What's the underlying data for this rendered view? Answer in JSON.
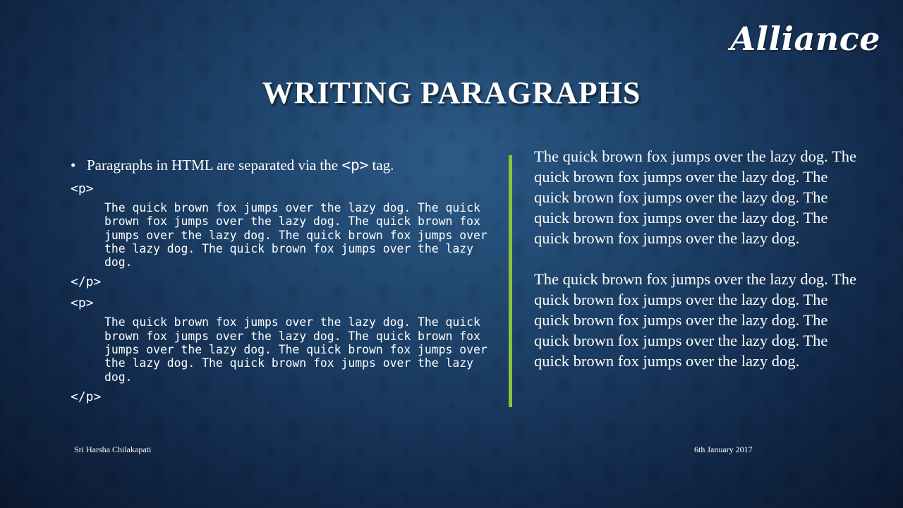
{
  "logo": {
    "text": "Alliance"
  },
  "title": "WRITING PARAGRAPHS",
  "left": {
    "bullet_prefix": "Paragraphs in HTML are separated via the ",
    "bullet_code": "<p>",
    "bullet_suffix": " tag.",
    "blocks": [
      {
        "open_tag": "<p>",
        "text": "The quick brown fox jumps over the lazy dog. The quick brown fox jumps over the lazy dog. The quick brown fox jumps over the lazy dog. The quick brown fox jumps over the lazy dog. The quick brown fox jumps over the lazy dog.",
        "close_tag": "</p>"
      },
      {
        "open_tag": "<p>",
        "text": "The quick brown fox jumps over the lazy dog. The quick brown fox jumps over the lazy dog. The quick brown fox jumps over the lazy dog. The quick brown fox jumps over the lazy dog. The quick brown fox jumps over the lazy dog.",
        "close_tag": "</p>"
      }
    ]
  },
  "right": {
    "paragraphs": [
      "The quick brown fox jumps over the lazy dog. The quick brown fox jumps over the lazy dog. The quick brown fox jumps over the lazy dog. The quick brown fox jumps over the lazy dog. The quick brown fox jumps over the lazy dog.",
      "The quick brown fox jumps over the lazy dog. The quick brown fox jumps over the lazy dog. The quick brown fox jumps over the lazy dog. The quick brown fox jumps over the lazy dog. The quick brown fox jumps over the lazy dog."
    ]
  },
  "footer": {
    "author": "Sri Harsha Chilakapati",
    "date": "6th January 2017"
  },
  "colors": {
    "divider": "#8cc43d",
    "background_center": "#2c5a86",
    "background_edge": "#0a182e"
  }
}
